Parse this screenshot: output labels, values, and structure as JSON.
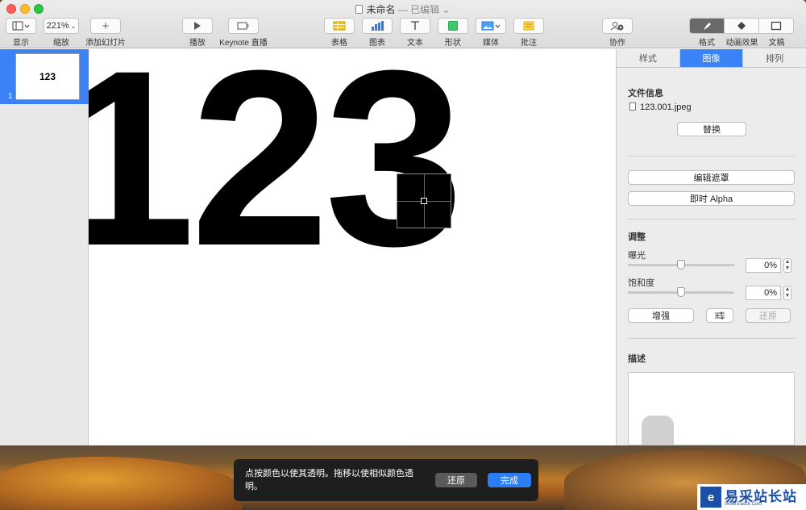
{
  "window": {
    "title": "未命名",
    "title_suffix": "— 已编辑 ⌄"
  },
  "toolbar": {
    "view_label": "显示",
    "zoom_value": "221%",
    "zoom_label": "缩放",
    "add_slide_label": "添加幻灯片",
    "play_label": "播放",
    "keynote_live_label": "Keynote 直播",
    "table_label": "表格",
    "chart_label": "图表",
    "text_label": "文本",
    "shape_label": "形状",
    "media_label": "媒体",
    "comment_label": "批注",
    "collaborate_label": "协作",
    "format_label": "格式",
    "animate_label": "动画效果",
    "document_label": "文稿"
  },
  "navigator": {
    "slide_number": "1",
    "slide_text": "123"
  },
  "canvas": {
    "text": "123"
  },
  "inspector": {
    "tabs": [
      "样式",
      "图像",
      "排列"
    ],
    "file_info_title": "文件信息",
    "file_name": "123.001.jpeg",
    "replace_label": "替换",
    "edit_mask_label": "编辑遮罩",
    "instant_alpha_label": "即时 Alpha",
    "adjust_title": "调整",
    "exposure_label": "曝光",
    "exposure_value": "0%",
    "saturation_label": "饱和度",
    "saturation_value": "0%",
    "enhance_label": "增强",
    "reset_label": "还原",
    "description_title": "描述"
  },
  "hud": {
    "message": "点按颜色以使其透明。拖移以使相似颜色透明。",
    "revert_label": "还原",
    "done_label": "完成"
  },
  "watermark": {
    "logo_char": "e",
    "text": "易采站长站",
    "url": "Www.Easck.Com"
  }
}
